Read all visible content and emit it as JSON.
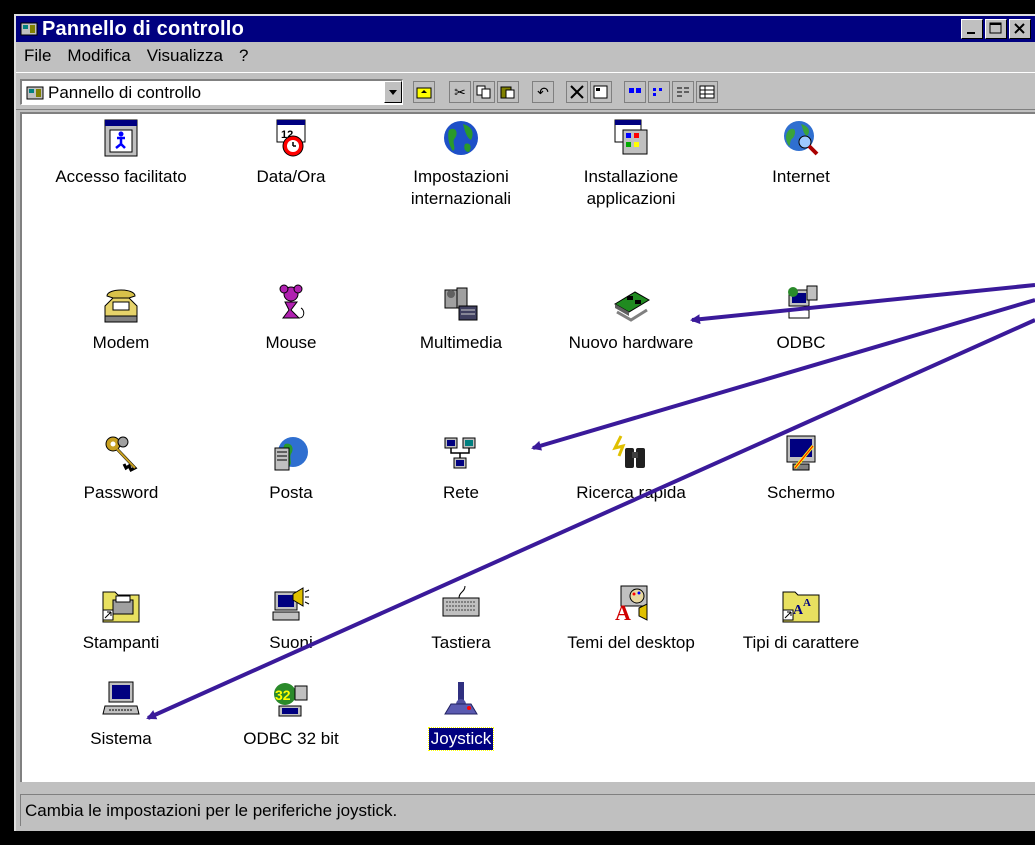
{
  "window": {
    "title": "Pannello di controllo"
  },
  "menu": [
    "File",
    "Modifica",
    "Visualizza",
    "?"
  ],
  "address": {
    "value": "Pannello di controllo"
  },
  "items": [
    {
      "label": "Accesso facilitato",
      "icon": "accessibility-icon"
    },
    {
      "label": "Data/Ora",
      "icon": "calendar-clock-icon"
    },
    {
      "label": "Impostazioni internazionali",
      "icon": "globe-icon"
    },
    {
      "label": "Installazione applicazioni",
      "icon": "install-programs-icon"
    },
    {
      "label": "Internet",
      "icon": "internet-globe-icon"
    },
    {
      "label": "Modem",
      "icon": "telephone-modem-icon"
    },
    {
      "label": "Mouse",
      "icon": "mouse-icon"
    },
    {
      "label": "Multimedia",
      "icon": "multimedia-icon"
    },
    {
      "label": "Nuovo hardware",
      "icon": "hardware-card-icon"
    },
    {
      "label": "ODBC",
      "icon": "odbc-icon"
    },
    {
      "label": "Password",
      "icon": "keys-icon"
    },
    {
      "label": "Posta",
      "icon": "mail-globe-icon"
    },
    {
      "label": "Rete",
      "icon": "network-icon"
    },
    {
      "label": "Ricerca rapida",
      "icon": "binoculars-icon"
    },
    {
      "label": "Schermo",
      "icon": "monitor-icon"
    },
    {
      "label": "Stampanti",
      "icon": "printer-folder-icon"
    },
    {
      "label": "Suoni",
      "icon": "speaker-computer-icon"
    },
    {
      "label": "Tastiera",
      "icon": "keyboard-icon"
    },
    {
      "label": "Temi del desktop",
      "icon": "desktop-themes-icon"
    },
    {
      "label": "Tipi di carattere",
      "icon": "fonts-folder-icon"
    },
    {
      "label": "Sistema",
      "icon": "computer-icon"
    },
    {
      "label": "ODBC 32 bit",
      "icon": "odbc-32-icon"
    },
    {
      "label": "Joystick",
      "icon": "joystick-icon",
      "selected": true
    }
  ],
  "status": {
    "text": "Cambia le impostazioni per le periferiche joystick."
  },
  "colors": {
    "titlebar": "#000080",
    "arrows": "#3a1a9a",
    "face": "#c0c0c0"
  }
}
